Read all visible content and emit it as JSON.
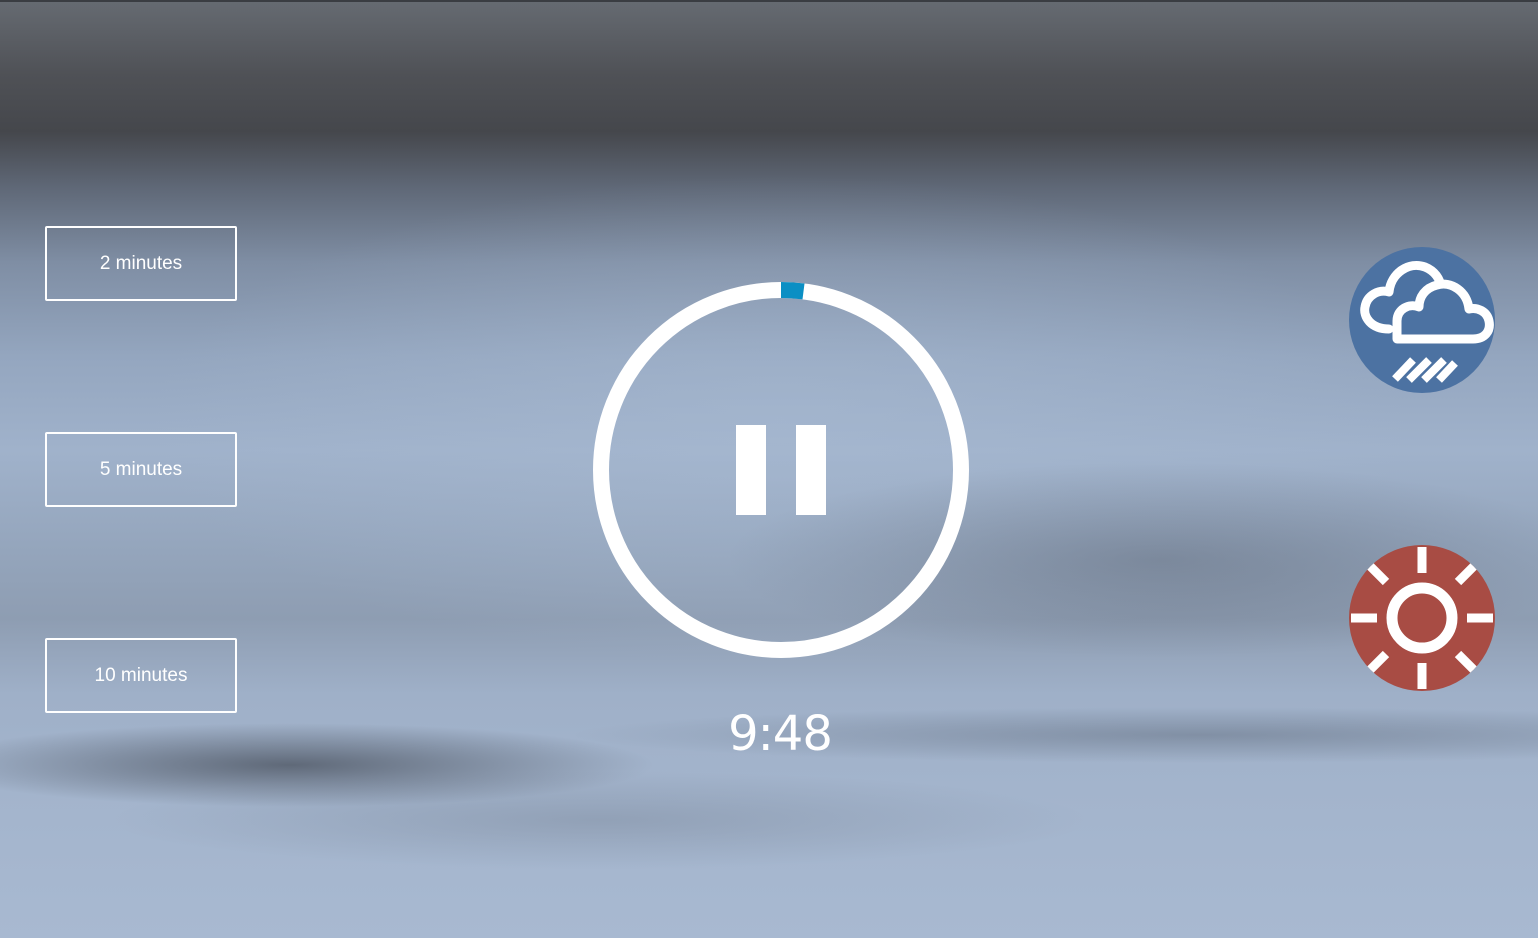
{
  "durations": {
    "two": "2 minutes",
    "five": "5 minutes",
    "ten": "10 minutes"
  },
  "timer": {
    "display": "9:48",
    "elapsed_fraction": 0.02,
    "state": "playing",
    "control_icon": "pause-icon"
  },
  "sounds": [
    {
      "icon": "rain-cloud-icon",
      "color": "#4c72a2"
    },
    {
      "icon": "sun-icon",
      "color": "#a84c44"
    }
  ],
  "colors": {
    "progress_accent": "#0b8fc4",
    "ring": "#ffffff"
  }
}
